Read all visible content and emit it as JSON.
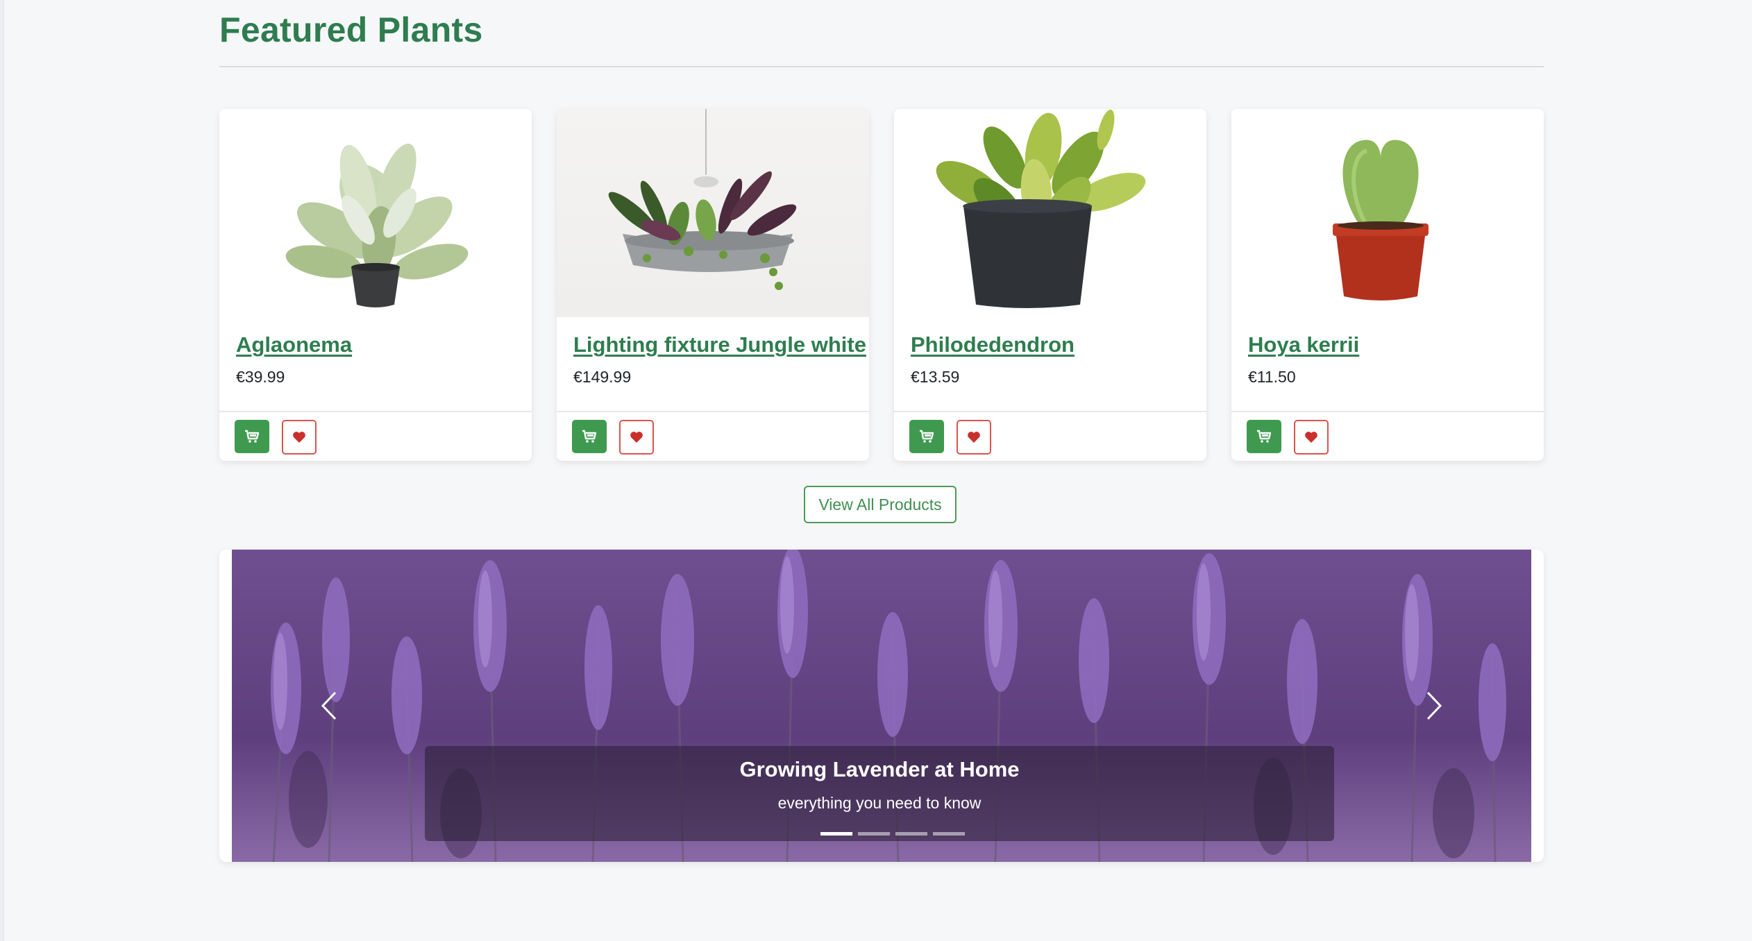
{
  "section": {
    "title": "Featured Plants"
  },
  "products": [
    {
      "name": "Aglaonema",
      "price": "€39.99"
    },
    {
      "name": "Lighting fixture Jungle white",
      "price": "€149.99"
    },
    {
      "name": "Philodedendron",
      "price": "€13.59"
    },
    {
      "name": "Hoya kerrii",
      "price": "€11.50"
    }
  ],
  "actions": {
    "cart_icon": "shopping-cart-icon",
    "favorite_icon": "heart-icon"
  },
  "view_all": {
    "label": "View All Products"
  },
  "carousel": {
    "slide_title": "Growing Lavender at Home",
    "slide_subtitle": "everything you need to know",
    "slide_count": 4,
    "active_index": 0,
    "prev_icon": "chevron-left-icon",
    "next_icon": "chevron-right-icon"
  },
  "colors": {
    "brand_green": "#2e7d4f",
    "cart_button": "#3f9a4f",
    "favorite_red": "#d9534f",
    "background": "#f6f7f9"
  }
}
